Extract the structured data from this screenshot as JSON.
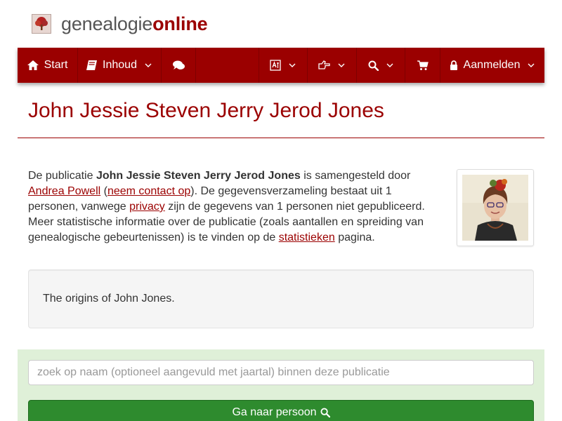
{
  "brand": {
    "part1": "genealogie",
    "part2": "online",
    "logo_icon": "tree-icon"
  },
  "nav": {
    "start_label": "Start",
    "content_label": "Inhoud",
    "login_label": "Aanmelden",
    "icons": [
      "home-icon",
      "book-icon",
      "comments-icon",
      "language-icon",
      "hand-point-right-icon",
      "search-icon",
      "shopping-cart-icon",
      "lock-icon"
    ]
  },
  "title": "John Jessie Steven Jerry Jerod Jones",
  "intro": {
    "t1": "De publicatie ",
    "pub_name": "John Jessie Steven Jerry Jerod Jones",
    "t2": " is samengesteld door ",
    "author": "Andrea Powell",
    "t3": " (",
    "contact": "neem contact op",
    "t4": "). De gegevensverzameling bestaat uit 1 personen, vanwege ",
    "privacy": "privacy",
    "t5": " zijn de gegevens van 1 personen niet gepubliceerd. Meer statistische informatie over de publicatie (zoals aantallen en spreiding van genealogische gebeurtenissen) is te vinden op de ",
    "stats": "statistieken",
    "t6": " pagina."
  },
  "description": "The origins of John Jones.",
  "search": {
    "placeholder": "zoek op naam (optioneel aangevuld met jaartal) binnen deze publicatie",
    "button_label": "Ga naar persoon"
  },
  "colors": {
    "brand": "#9b0000",
    "panel": "#dff0d8",
    "button": "#2e8b2e"
  }
}
